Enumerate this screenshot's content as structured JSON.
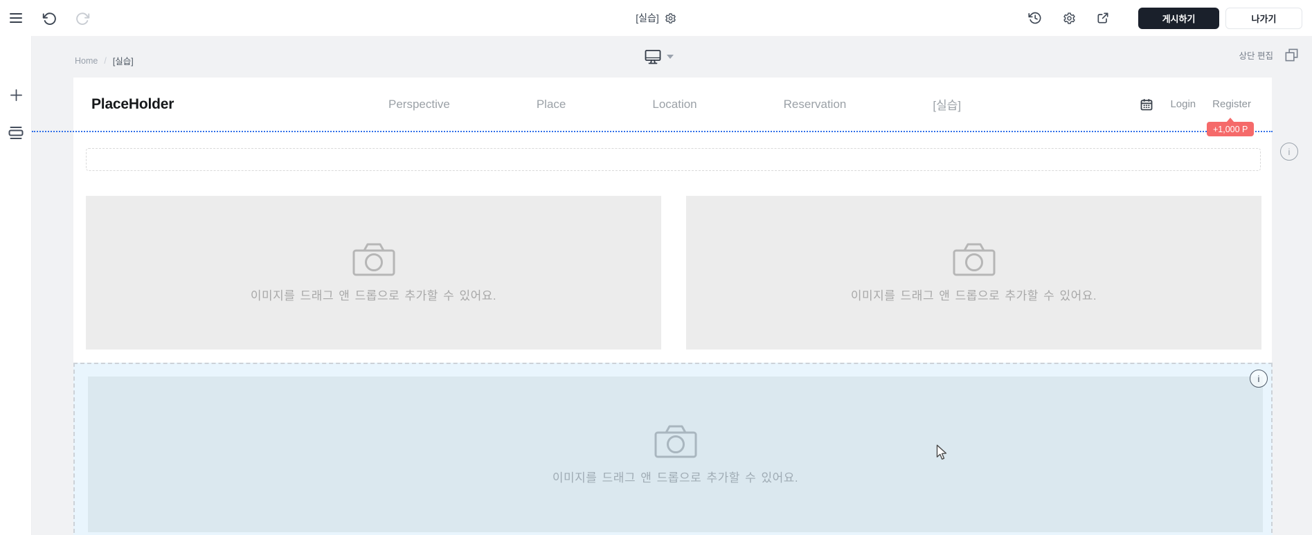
{
  "topbar": {
    "title": "[실습]",
    "publish": "게시하기",
    "exit": "나가기"
  },
  "breadcrumb": {
    "home": "Home",
    "sep": "/",
    "current": "[실습]"
  },
  "top_edit_label": "상단 편집",
  "site": {
    "logo": "PlaceHolder",
    "nav": [
      "Perspective",
      "Place",
      "Location",
      "Reservation",
      "[실습]"
    ],
    "login": "Login",
    "register": "Register",
    "points_badge": "+1,000 P"
  },
  "placeholder_text": "이미지를 드래그 앤 드롭으로 추가할 수 있어요.",
  "info_symbol": "i",
  "colors": {
    "accent_blue": "#2e6ee8",
    "badge_red": "#f56a6a",
    "publish_button": "#1a202b",
    "section_highlight": "#e9f5fd",
    "image_box_blue": "#dbe8ef",
    "image_box_gray": "#ececec"
  }
}
